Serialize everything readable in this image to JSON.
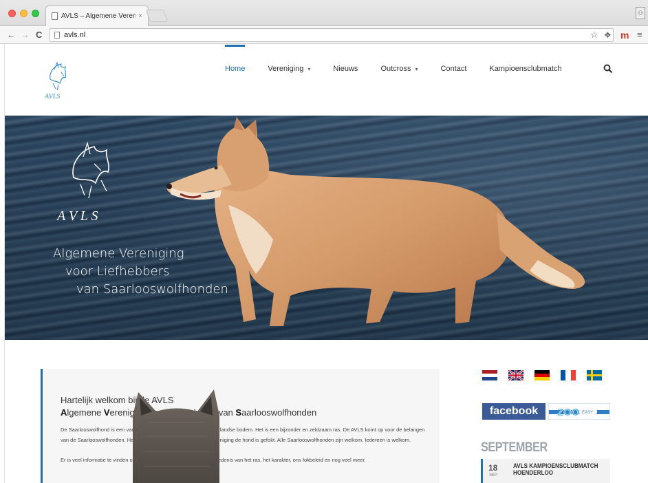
{
  "browser": {
    "tab_title": "AVLS – Algemene Verenig",
    "tab_close": "×",
    "url": "avls.nl",
    "icons": [
      "back-arrow-icon",
      "forward-arrow-icon",
      "reload-icon",
      "star-icon",
      "extension-icon",
      "menu-icon"
    ]
  },
  "site": {
    "logo_text": "AVLS",
    "nav": {
      "items": [
        {
          "label": "Home",
          "active": true,
          "dropdown": false
        },
        {
          "label": "Vereniging",
          "active": false,
          "dropdown": true
        },
        {
          "label": "Nieuws",
          "active": false,
          "dropdown": false
        },
        {
          "label": "Outcross",
          "active": false,
          "dropdown": true
        },
        {
          "label": "Contact",
          "active": false,
          "dropdown": false
        },
        {
          "label": "Kampioensclubmatch",
          "active": false,
          "dropdown": false
        }
      ],
      "caret": "▾",
      "search_icon": "search-icon"
    },
    "hero": {
      "logo_text": "A V L S",
      "tagline": [
        "Algemene Vereniging",
        "voor Liefhebbers",
        "van Saarlooswolfhonden"
      ]
    },
    "welcome": {
      "heading": "Hartelijk welkom bij de AVLS",
      "sub_parts": [
        "A",
        "lgemene ",
        "V",
        "ereniging voor ",
        "L",
        "iefhebbers van ",
        "S",
        "aarlooswolfhonden"
      ],
      "paragraph1": "De Saarlooswolfhond is een van de weinige hondenrassen van Nederlandse bodem. Het is een bijzonder en zeldzaam ras. De AVLS komt op voor de belangen van de Saarlooswolfhonden. Het maakt voor ons niet uit in welke vereniging de hond is gefokt. Alle Saarlooswolfhonden zijn welkom. Iedereen is welkom.",
      "paragraph2": "Er is veel informatie te vinden op deze website, zowel over de geschiedenis van het ras, het karakter, ons fokbeleid en nog veel meer."
    },
    "languages": [
      {
        "code": "nl",
        "colors": [
          "#ae1c28",
          "#ffffff",
          "#21468b"
        ]
      },
      {
        "code": "en",
        "colors": [
          "#012169",
          "#ffffff",
          "#c8102e"
        ]
      },
      {
        "code": "de",
        "colors": [
          "#000000",
          "#dd0000",
          "#ffce00"
        ]
      },
      {
        "code": "fr",
        "colors": [
          "#0055a4",
          "#ffffff",
          "#ef4135"
        ]
      },
      {
        "code": "se",
        "colors": [
          "#006aa7",
          "#fecc00"
        ]
      }
    ],
    "social": {
      "facebook_label": "facebook",
      "zoo_label": "ZOO",
      "zoo_sub": "EASY"
    },
    "agenda": {
      "month": "SEPTEMBER",
      "events": [
        {
          "day": "18",
          "month_short": "SEP",
          "title": "AVLS KAMPIOENSCLUBMATCH HOENDERLOO"
        }
      ]
    },
    "colors": {
      "accent": "#1f6fb2",
      "facebook": "#3b5b98"
    }
  }
}
